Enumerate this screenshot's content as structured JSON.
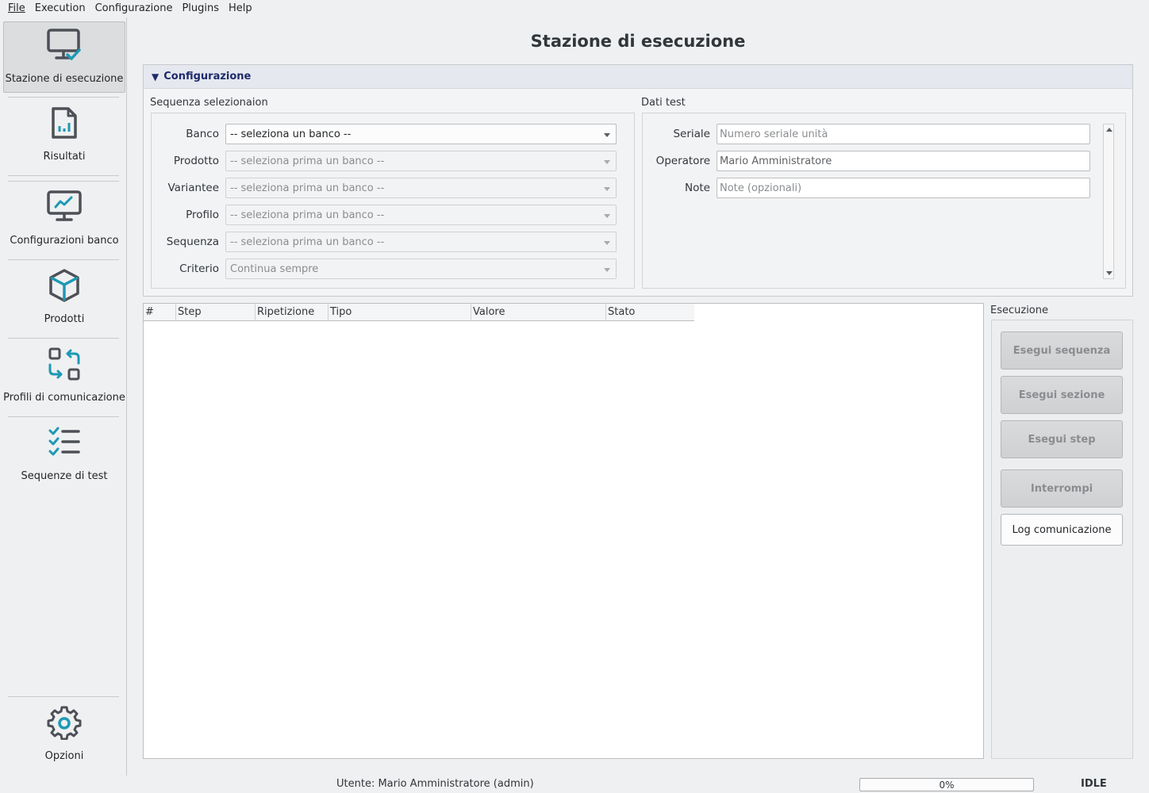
{
  "menu": [
    "File",
    "Execution",
    "Configurazione",
    "Plugins",
    "Help"
  ],
  "sidebar": {
    "items": [
      {
        "label": "Stazione di esecuzione",
        "icon": "monitor-check-icon"
      },
      {
        "label": "Risultati",
        "icon": "report-chart-icon"
      },
      {
        "label": "Configurazioni banco",
        "icon": "monitor-chart-icon"
      },
      {
        "label": "Prodotti",
        "icon": "cube-icon"
      },
      {
        "label": "Profili di comunicazione",
        "icon": "swap-arrows-icon"
      },
      {
        "label": "Sequenze di test",
        "icon": "checklist-icon"
      }
    ],
    "options_label": "Opzioni",
    "options_icon": "gear-icon"
  },
  "page": {
    "title": "Stazione di esecuzione"
  },
  "config": {
    "header": "Configurazione",
    "sequence_group": {
      "title": "Sequenza selezionaion",
      "rows": [
        {
          "label": "Banco",
          "value": "-- seleziona un banco --",
          "enabled": true
        },
        {
          "label": "Prodotto",
          "value": "-- seleziona prima un banco --",
          "enabled": false
        },
        {
          "label": "Variantee",
          "value": "-- seleziona prima un banco --",
          "enabled": false
        },
        {
          "label": "Profilo",
          "value": "-- seleziona prima un banco --",
          "enabled": false
        },
        {
          "label": "Sequenza",
          "value": "-- seleziona prima un banco --",
          "enabled": false
        },
        {
          "label": "Criterio",
          "value": "Continua sempre",
          "enabled": false
        }
      ]
    },
    "test_group": {
      "title": "Dati test",
      "rows": [
        {
          "label": "Seriale",
          "placeholder": "Numero seriale unità",
          "value": ""
        },
        {
          "label": "Operatore",
          "placeholder": "",
          "value": "Mario Amministratore"
        },
        {
          "label": "Note",
          "placeholder": "Note (opzionali)",
          "value": ""
        }
      ]
    }
  },
  "table": {
    "columns": [
      "#",
      "Step",
      "Ripetizione",
      "Tipo",
      "Valore",
      "Stato"
    ],
    "rows": []
  },
  "execution": {
    "title": "Esecuzione",
    "buttons": [
      {
        "label": "Esegui sequenza",
        "enabled": false
      },
      {
        "label": "Esegui sezione",
        "enabled": false
      },
      {
        "label": "Esegui step",
        "enabled": false
      },
      {
        "label": "Interrompi",
        "enabled": false
      },
      {
        "label": "Log comunicazione",
        "enabled": true
      }
    ]
  },
  "status": {
    "user": "Utente: Mario Amministratore (admin)",
    "progress": 0,
    "progress_text": "0%",
    "state": "IDLE"
  },
  "colors": {
    "accent": "#1d99b4",
    "icon": "#4d5057",
    "header_text": "#1d2b6b"
  }
}
